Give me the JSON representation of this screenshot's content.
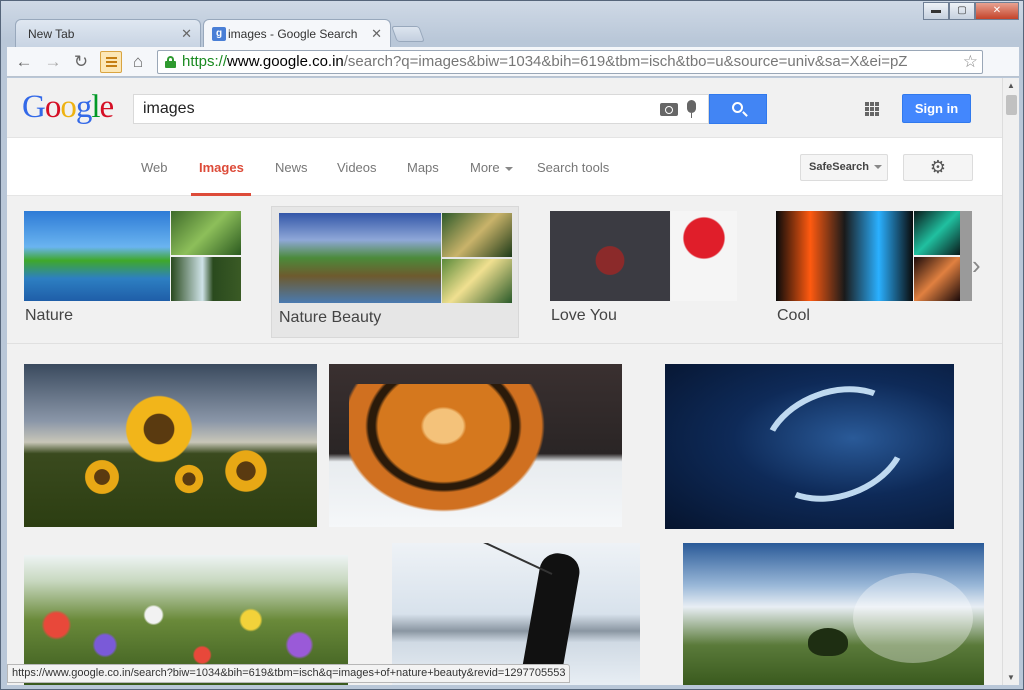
{
  "window": {
    "tabs": [
      {
        "title": "New Tab"
      },
      {
        "title": "images - Google Search",
        "favicon": "g"
      }
    ],
    "controls": {
      "minimize": "▬",
      "maximize": "▢",
      "close": "✕"
    }
  },
  "toolbar": {
    "url_scheme": "https://",
    "url_host": "www.google.co.in",
    "url_rest": "/search?q=images&biw=1034&bih=619&tbm=isch&tbo=u&source=univ&sa=X&ei=pZ"
  },
  "google": {
    "logo": "Google",
    "logo_colors": [
      "#3369e8",
      "#d50f25",
      "#eeb211",
      "#3369e8",
      "#009925",
      "#d50f25"
    ],
    "query": "images",
    "sign_in": "Sign in",
    "nav": [
      {
        "label": "Web"
      },
      {
        "label": "Images",
        "selected": true
      },
      {
        "label": "News"
      },
      {
        "label": "Videos"
      },
      {
        "label": "Maps"
      },
      {
        "label": "More"
      },
      {
        "label": "Search tools"
      }
    ],
    "safesearch": "SafeSearch"
  },
  "related": [
    {
      "label": "Nature"
    },
    {
      "label": "Nature Beauty"
    },
    {
      "label": "Love You"
    },
    {
      "label": "Cool"
    }
  ],
  "status_url": "https://www.google.co.in/search?biw=1034&bih=619&tbm=isch&q=images+of+nature+beauty&revid=1297705553",
  "icons": {
    "back": "back-arrow-icon",
    "forward": "forward-arrow-icon",
    "reload": "reload-icon",
    "home": "home-icon",
    "settings": "gear-icon"
  }
}
